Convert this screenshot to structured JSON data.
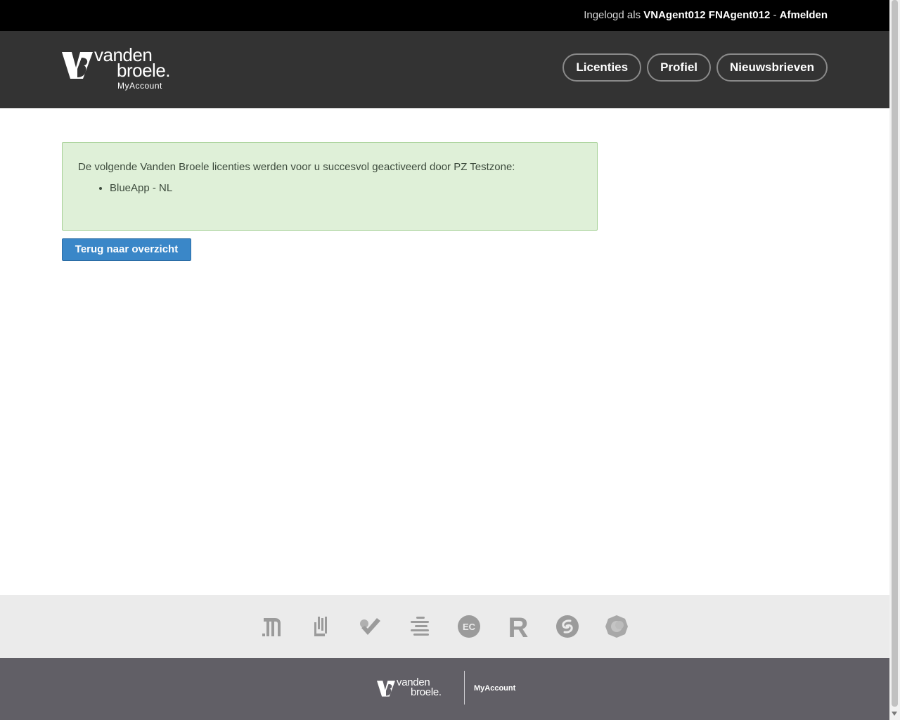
{
  "userbar": {
    "prefix": "Ingelogd als",
    "username": "VNAgent012 FNAgent012",
    "separator": "-",
    "logout": "Afmelden"
  },
  "header": {
    "brand_line1": "vanden",
    "brand_line2": "broele.",
    "brand_sub": "MyAccount",
    "nav": [
      {
        "label": "Licenties"
      },
      {
        "label": "Profiel"
      },
      {
        "label": "Nieuwsbrieven"
      }
    ]
  },
  "main": {
    "alert_message": "De volgende Vanden Broele licenties werden voor u succesvol geactiveerd door PZ Testzone:",
    "licenses": [
      "BlueApp - NL"
    ],
    "back_button": "Terug naar overzicht"
  },
  "product_logos": [
    "columns-logo-icon",
    "hand-logo-icon",
    "check-logo-icon",
    "lines-logo-icon",
    "ec-logo-icon",
    "r-logo-icon",
    "swirl-logo-icon",
    "gear-logo-icon"
  ],
  "product_logo_texts": {
    "ec": "EC",
    "r": "R"
  },
  "footer": {
    "brand_line1": "vanden",
    "brand_line2": "broele.",
    "sub": "MyAccount"
  },
  "colors": {
    "header_bg": "#333333",
    "alert_bg": "#dff0d8",
    "button_bg": "#3a87c8",
    "footer_bg": "#615f66"
  }
}
